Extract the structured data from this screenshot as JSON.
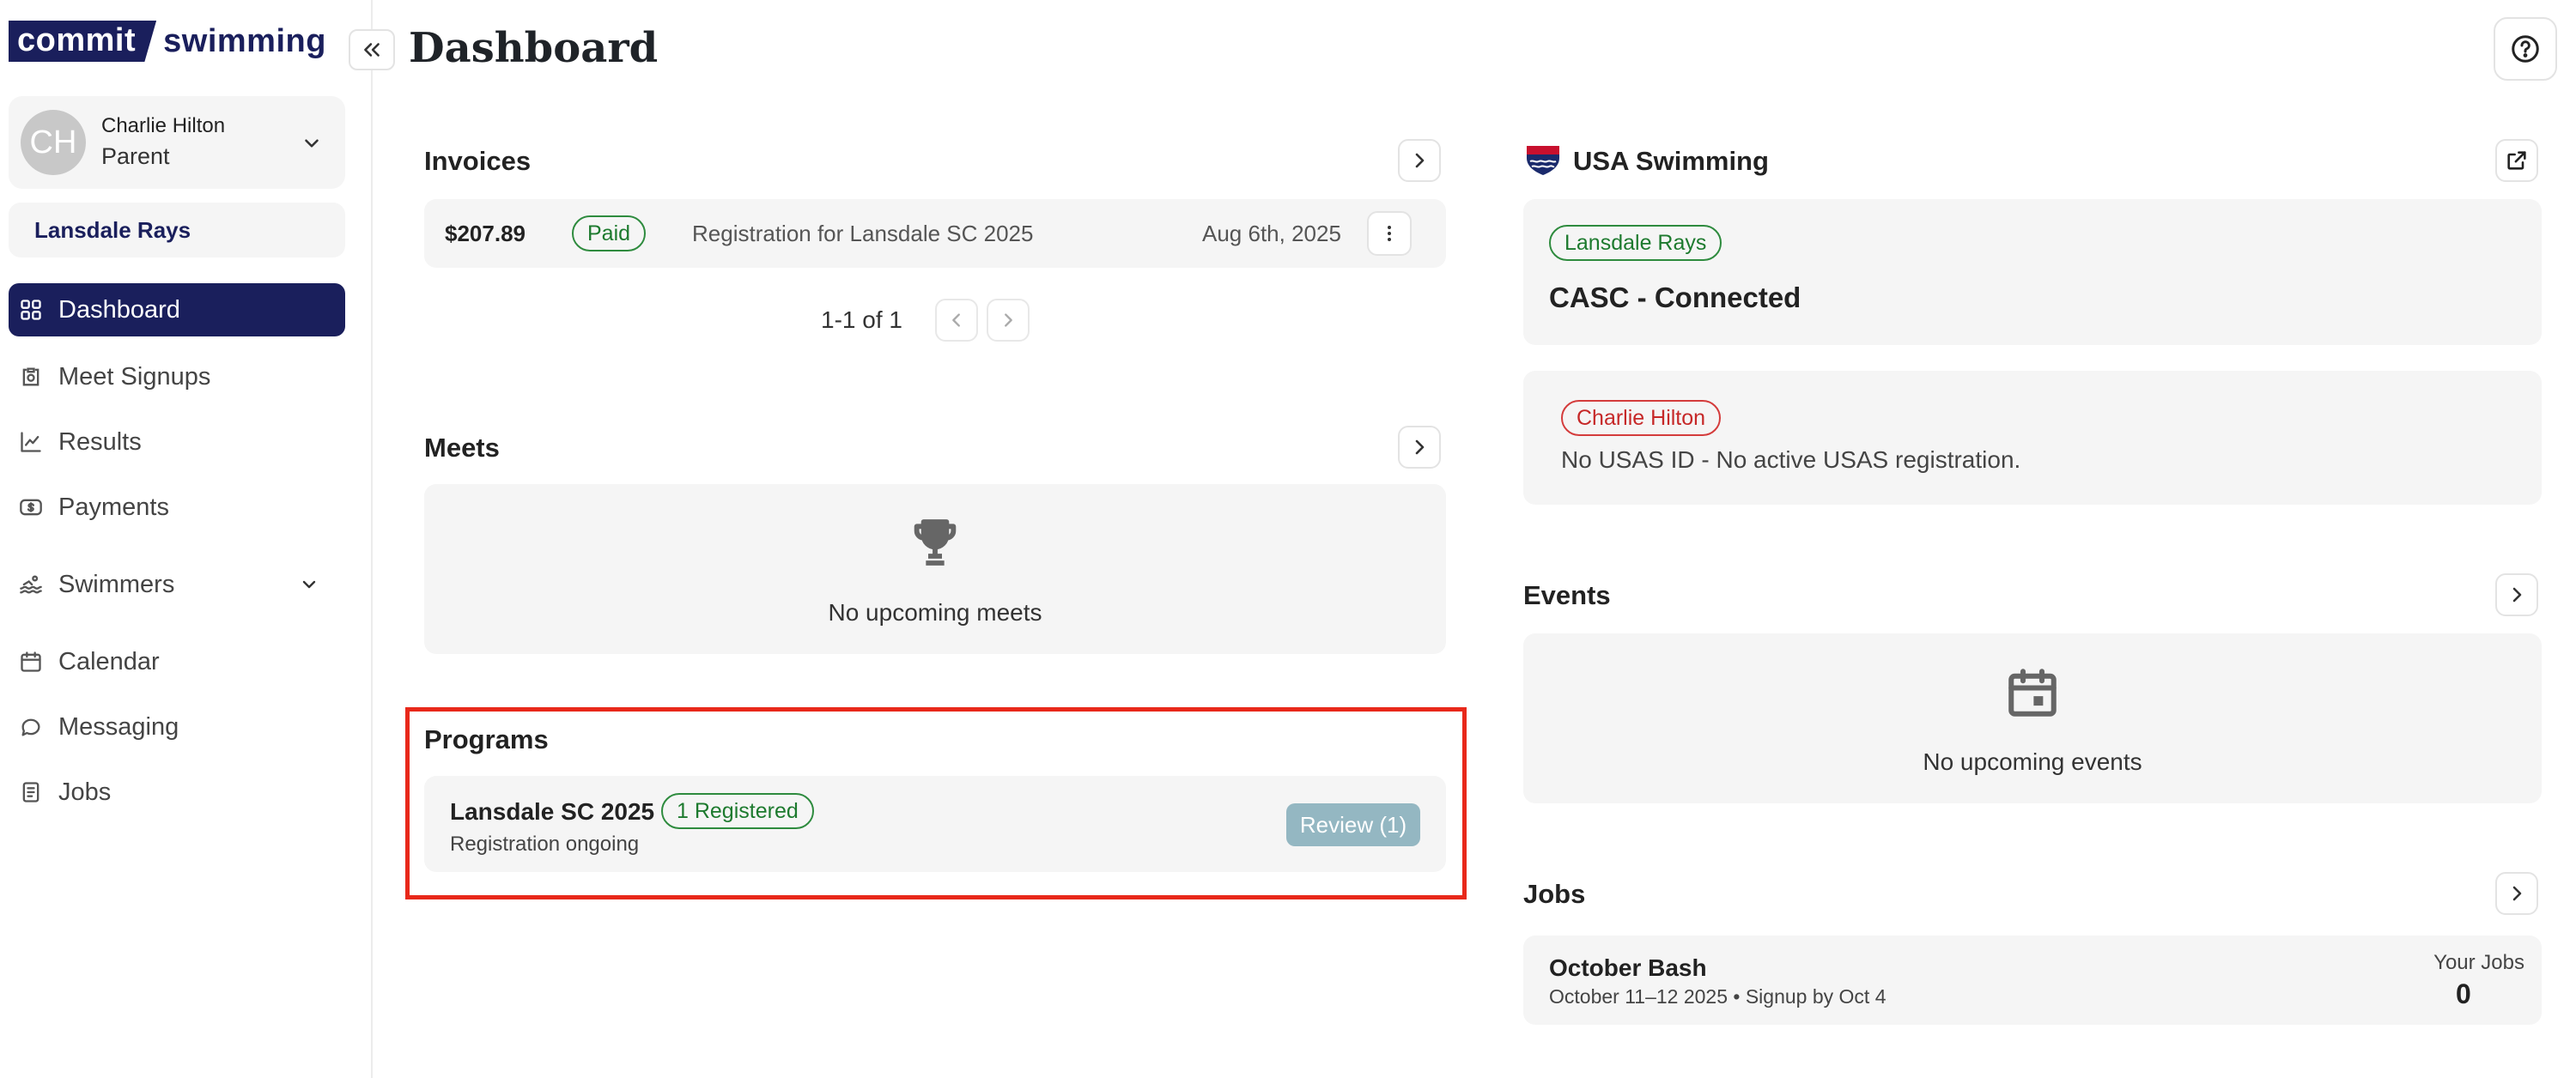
{
  "logo": {
    "part1": "commit",
    "part2": "swimming"
  },
  "user": {
    "initials": "CH",
    "name": "Charlie Hilton",
    "role": "Parent"
  },
  "team": {
    "name": "Lansdale Rays"
  },
  "nav": [
    {
      "label": "Dashboard",
      "icon": "grid-icon",
      "active": true
    },
    {
      "label": "Meet Signups",
      "icon": "clipboard-icon"
    },
    {
      "label": "Results",
      "icon": "line-chart-icon"
    },
    {
      "label": "Payments",
      "icon": "dollar-icon"
    },
    {
      "label": "Swimmers",
      "icon": "swimmer-icon",
      "expandable": true
    },
    {
      "label": "Calendar",
      "icon": "calendar-icon"
    },
    {
      "label": "Messaging",
      "icon": "chat-icon"
    },
    {
      "label": "Jobs",
      "icon": "list-icon"
    }
  ],
  "page": {
    "title": "Dashboard"
  },
  "invoices": {
    "title": "Invoices",
    "rows": [
      {
        "amount": "$207.89",
        "status": "Paid",
        "description": "Registration for Lansdale SC 2025",
        "date": "Aug 6th, 2025"
      }
    ],
    "pagination": "1-1 of 1"
  },
  "meets": {
    "title": "Meets",
    "empty": "No upcoming meets"
  },
  "programs": {
    "title": "Programs",
    "items": [
      {
        "name": "Lansdale SC 2025",
        "badge": "1 Registered",
        "status": "Registration ongoing",
        "action": "Review (1)"
      }
    ]
  },
  "usa_swimming": {
    "title": "USA Swimming",
    "club_badge": "Lansdale Rays",
    "club_status": "CASC - Connected",
    "member_badge": "Charlie Hilton",
    "member_status": "No USAS ID - No active USAS registration."
  },
  "events": {
    "title": "Events",
    "empty": "No upcoming events"
  },
  "jobs": {
    "title": "Jobs",
    "items": [
      {
        "name": "October Bash",
        "details": "October 11–12 2025 • Signup by Oct 4",
        "label": "Your Jobs",
        "count": "0"
      }
    ]
  },
  "colors": {
    "brand": "#1a1f5c",
    "highlight": "#e8281a",
    "success": "#2e8b3e",
    "danger": "#d43c3c",
    "review": "#94b7c2"
  }
}
